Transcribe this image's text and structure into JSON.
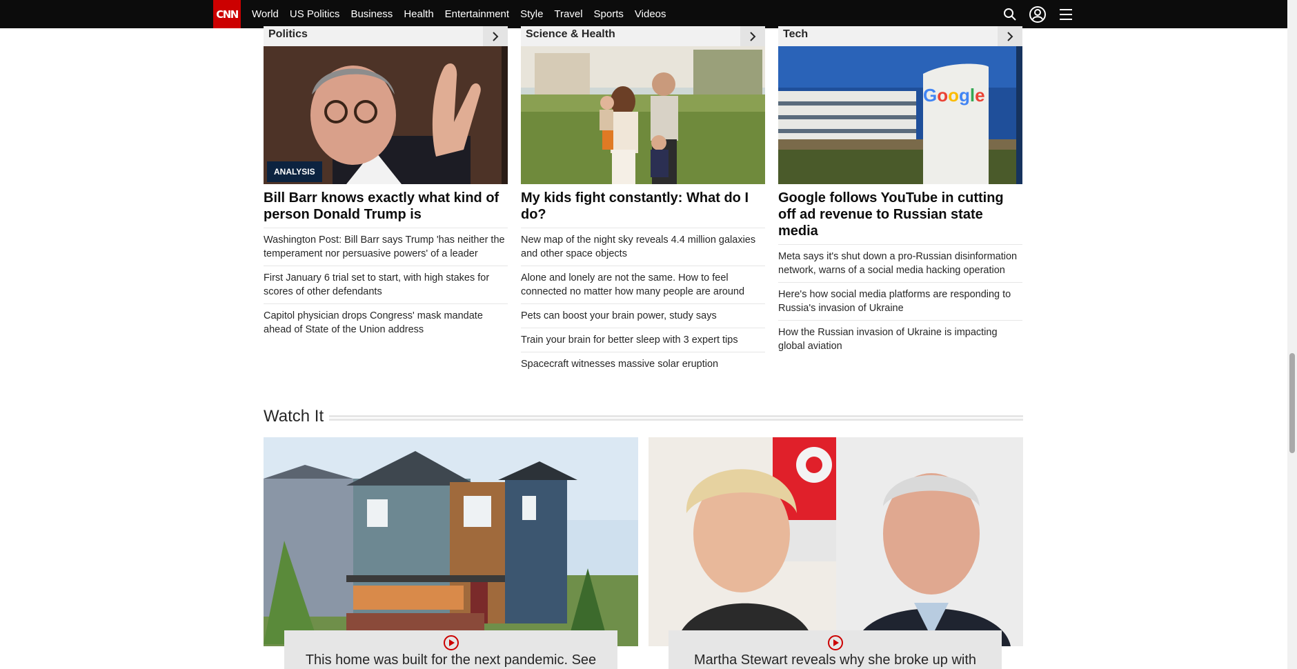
{
  "nav": {
    "logo": "CNN",
    "links": [
      "World",
      "US Politics",
      "Business",
      "Health",
      "Entertainment",
      "Style",
      "Travel",
      "Sports",
      "Videos"
    ]
  },
  "columns": [
    {
      "section": "Politics",
      "badge": "ANALYSIS",
      "headline": "Bill Barr knows exactly what kind of person Donald Trump is",
      "stories": [
        "Washington Post: Bill Barr says Trump 'has neither the temperament nor persuasive powers' of a leader",
        "First January 6 trial set to start, with high stakes for scores of other defendants",
        "Capitol physician drops Congress' mask mandate ahead of State of the Union address"
      ]
    },
    {
      "section": "Science & Health",
      "headline": "My kids fight constantly: What do I do?",
      "stories": [
        "New map of the night sky reveals 4.4 million galaxies and other space objects",
        "Alone and lonely are not the same. How to feel connected no matter how many people are around",
        "Pets can boost your brain power, study says",
        "Train your brain for better sleep with 3 expert tips",
        "Spacecraft witnesses massive solar eruption"
      ]
    },
    {
      "section": "Tech",
      "image_sign": "Google",
      "headline": "Google follows YouTube in cutting off ad revenue to Russian state media",
      "stories": [
        "Meta says it's shut down a pro-Russian disinformation network, warns of a social media hacking operation",
        "Here's how social media platforms are responding to Russia's invasion of Ukraine",
        "How the Russian invasion of Ukraine is impacting global aviation"
      ]
    }
  ],
  "watch": {
    "title": "Watch It",
    "videos": [
      {
        "caption": "This home was built for the next pandemic. See"
      },
      {
        "caption": "Martha Stewart reveals why she broke up with"
      }
    ]
  },
  "colors": {
    "brand": "#cc0000",
    "nav_bg": "#0c0c0c",
    "badge_bg": "#0c2340"
  }
}
